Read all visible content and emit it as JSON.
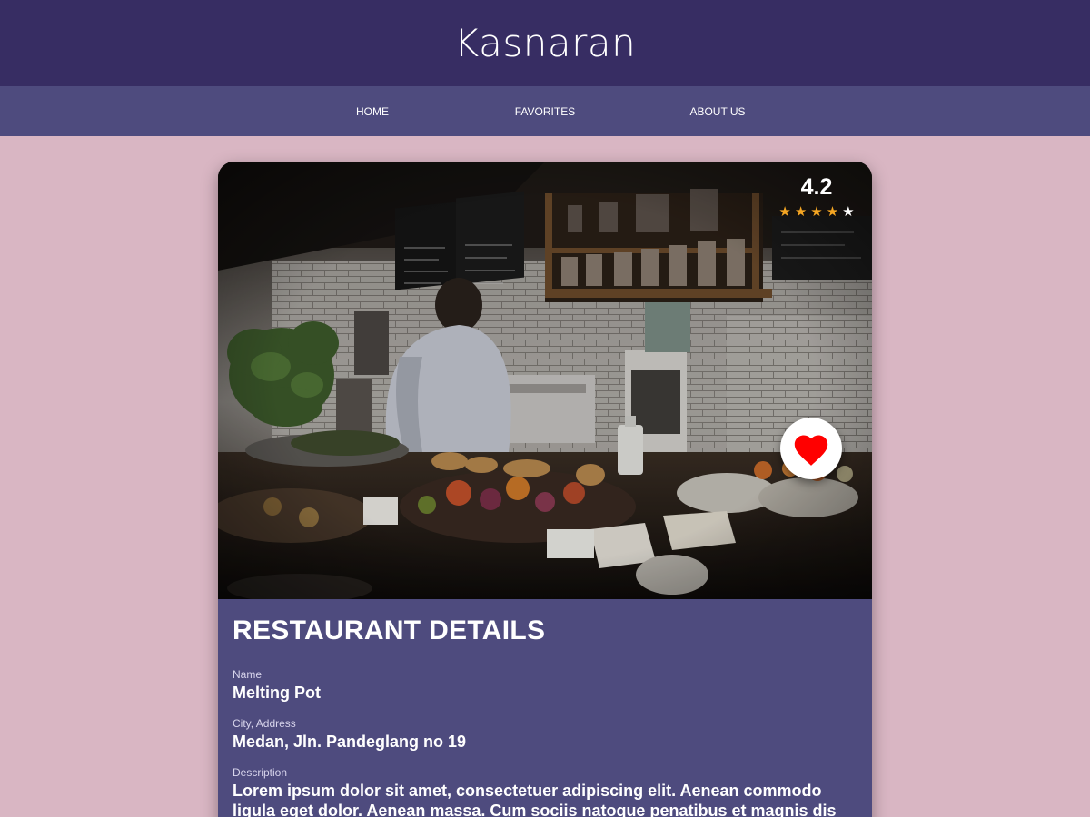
{
  "app": {
    "title": "Kasnaran"
  },
  "nav": {
    "items": [
      {
        "label": "HOME"
      },
      {
        "label": "FAVORITES"
      },
      {
        "label": "ABOUT US"
      }
    ]
  },
  "restaurant": {
    "rating": "4.2",
    "rating_value": 4.2,
    "stars": {
      "filled": 4,
      "total": 5,
      "filled_color": "#f5a623",
      "empty_color": "#ffffff"
    },
    "section_title": "RESTAURANT DETAILS",
    "name_label": "Name",
    "name": "Melting Pot",
    "address_label": "City, Address",
    "address": "Medan, Jln. Pandeglang no 19",
    "description_label": "Description",
    "description": "Lorem ipsum dolor sit amet, consectetuer adipiscing elit. Aenean commodo ligula eget dolor. Aenean massa. Cum sociis natoque penatibus et magnis dis parturient montes, nascetur ridiculus mus."
  },
  "favorite": {
    "icon": "heart-icon",
    "color": "#ff0000"
  },
  "colors": {
    "header": "#372d63",
    "nav": "#4e4b7e",
    "background": "#d9b6c3",
    "card": "#4e4b7e"
  }
}
